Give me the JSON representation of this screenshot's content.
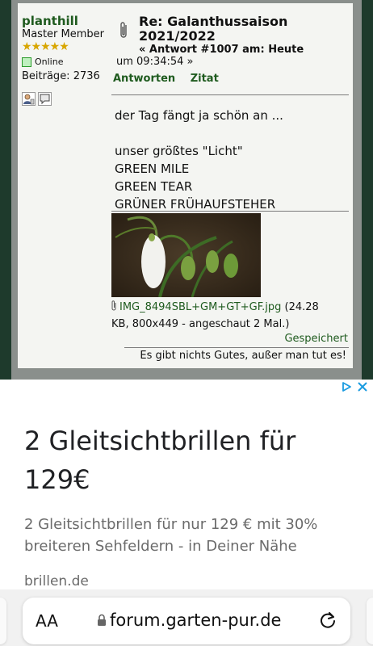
{
  "post": {
    "author": {
      "name": "planthill",
      "rank": "Master Member",
      "stars": "★★★★★",
      "status": "Online",
      "posts_label": "Beiträge: 2736"
    },
    "title_line1": "Re: Galanthussaison",
    "title_line2": "2021/2022",
    "reply_label": "« Antwort #1007 am: Heute",
    "time": "um 09:34:54 »",
    "actions": {
      "answer": "Antworten",
      "quote": "Zitat"
    },
    "body": {
      "line1": "der Tag fängt ja schön an ...",
      "line2": "unser größtes \"Licht\"",
      "line3": "GREEN MILE",
      "line4": "GREEN TEAR",
      "line5": "GRÜNER FRÜHAUFSTEHER"
    },
    "attachment": {
      "filename": "IMG_8494SBL+GM+GT+GF.jpg",
      "info_1": " (24.28",
      "info_2": "KB, 800x449 - angeschaut 2 Mal.)"
    },
    "saved_label": "Gespeichert",
    "signature": "Es gibt nichts Gutes, außer man tut es!"
  },
  "ad": {
    "headline": "2 Gleitsichtbrillen für 129€",
    "description": "2 Gleitsichtbrillen für nur 129 € mit 30% breiteren Sehfeldern - in Deiner Nähe",
    "domain": "brillen.de"
  },
  "browser": {
    "text_size_button": "AA",
    "url": "forum.garten-pur.de"
  },
  "colors": {
    "link_green": "#1f5b1f",
    "ad_blue": "#1a9be0",
    "forum_dark": "#1e3a2c"
  }
}
